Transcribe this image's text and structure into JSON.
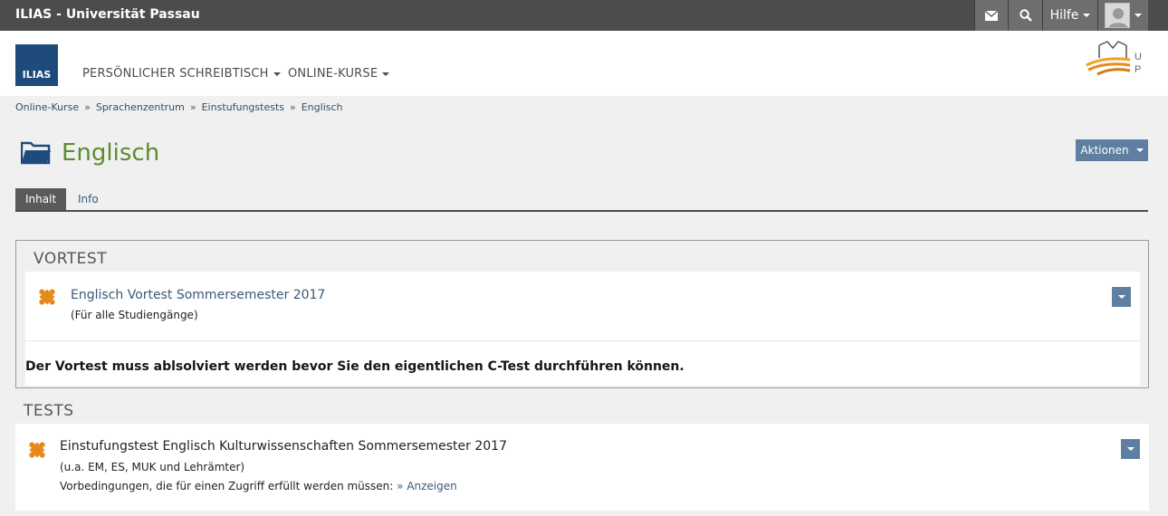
{
  "topbar": {
    "title": "ILIAS - Universität Passau",
    "help_label": "Hilfe"
  },
  "header": {
    "logo_text": "ILIAS",
    "nav": {
      "desk": "PERSÖNLICHER SCHREIBTISCH",
      "courses": "ONLINE-KURSE"
    }
  },
  "breadcrumb": [
    "Online-Kurse",
    "Sprachenzentrum",
    "Einstufungstests",
    "Englisch"
  ],
  "page": {
    "title": "Englisch",
    "actions_label": "Aktionen"
  },
  "tabs": {
    "content": "Inhalt",
    "info": "Info"
  },
  "vortest": {
    "heading": "VORTEST",
    "item_title": "Englisch Vortest Sommersemester 2017",
    "item_sub": "(Für alle Studiengänge)",
    "notice": "Der Vortest muss ablsolviert werden bevor Sie den eigentlichen C-Test durchführen können."
  },
  "tests": {
    "heading": "TESTS",
    "item_title": "Einstufungstest Englisch Kulturwissenschaften Sommersemester 2017",
    "item_sub": "(u.a. EM, ES, MUK und Lehrämter)",
    "prereq_label": "Vorbedingungen, die für einen Zugriff erfüllt werden müssen:",
    "prereq_link": "» Anzeigen"
  },
  "colors": {
    "topbar": "#4c4c4c",
    "brand_blue": "#1e4b7b",
    "title_green": "#5d8c2f",
    "button_blue": "#5e7fa1",
    "link": "#3a5a7a",
    "puzzle_orange": "#e8891c"
  }
}
